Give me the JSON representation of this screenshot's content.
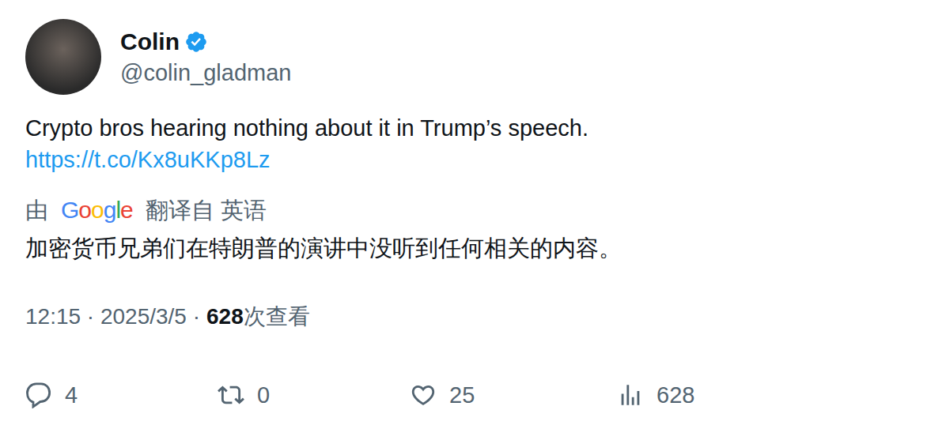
{
  "user": {
    "name": "Colin",
    "handle": "@colin_gladman",
    "verified": true
  },
  "tweet": {
    "text": "Crypto bros hearing nothing about it in Trump’s speech.",
    "link": "https://t.co/Kx8uKKp8Lz"
  },
  "translation": {
    "prefix": "由",
    "provider": "Google",
    "suffix": "翻译自 英语",
    "text": "加密货币兄弟们在特朗普的演讲中没听到任何相关的内容。"
  },
  "meta": {
    "timestamp": "12:15 · 2025/3/5 ·",
    "views": "628",
    "views_label": "次查看"
  },
  "actions": [
    {
      "kind": "reply",
      "count": "4"
    },
    {
      "kind": "retweet",
      "count": "0"
    },
    {
      "kind": "like",
      "count": "25"
    },
    {
      "kind": "views",
      "count": "628"
    }
  ]
}
